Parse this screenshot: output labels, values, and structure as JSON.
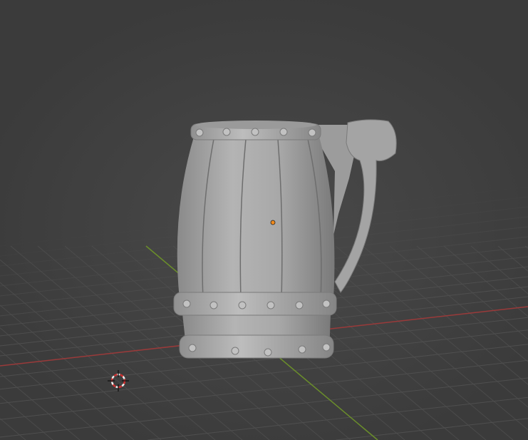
{
  "viewport": {
    "object": "tankard-mesh",
    "colors": {
      "background": "#3d3d3d",
      "grid": "#4f4f4f",
      "x_axis": "#9a3a3a",
      "y_axis": "#6b8f2a",
      "mesh": "#a9a9a9",
      "mesh_shadow": "#7c7c7c",
      "origin": "#f08a1c"
    },
    "icons": [
      "3d-cursor-icon",
      "object-origin-icon"
    ]
  }
}
